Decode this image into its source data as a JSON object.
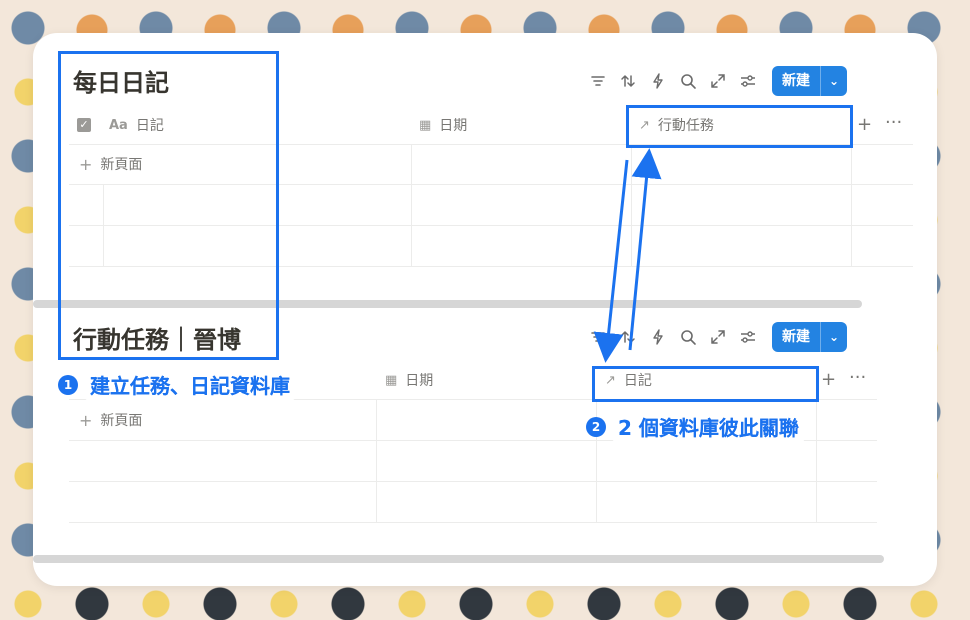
{
  "top": {
    "title": "每日日記",
    "columns": [
      {
        "icon": "title-icon",
        "label": "日記"
      },
      {
        "icon": "calendar-icon",
        "label": "日期"
      },
      {
        "icon": "relation-icon",
        "label": "行動任務"
      }
    ],
    "new_page_label": "新頁面",
    "new_button": "新建"
  },
  "bottom": {
    "title": "行動任務｜晉博",
    "columns": [
      {
        "icon": "calendar-icon",
        "label": "日期"
      },
      {
        "icon": "relation-icon",
        "label": "日記"
      }
    ],
    "new_page_label": "新頁面",
    "new_button": "新建"
  },
  "annotations": {
    "step1": {
      "number": "1",
      "text": "建立任務、日記資料庫"
    },
    "step2": {
      "number": "2",
      "text": "2 個資料庫彼此關聯"
    }
  },
  "colors": {
    "accent": "#1b72ef",
    "button": "#2383e2",
    "page_background": "#f3e7da"
  }
}
